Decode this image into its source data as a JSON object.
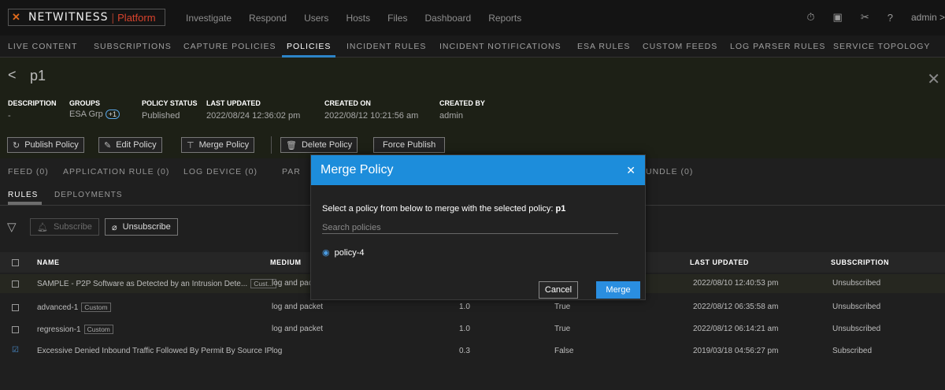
{
  "brand": {
    "name": "NETWITNESS",
    "separator": "|",
    "platform": "Platform"
  },
  "main_nav": [
    "Investigate",
    "Respond",
    "Users",
    "Hosts",
    "Files",
    "Dashboard",
    "Reports"
  ],
  "top_icons": {
    "timer": "⏱",
    "tasks": "▣",
    "tools": "✂",
    "help": "?",
    "user": "admin >"
  },
  "admin_tabs": [
    "LIVE CONTENT",
    "SUBSCRIPTIONS",
    "CAPTURE POLICIES",
    "POLICIES",
    "INCIDENT RULES",
    "INCIDENT NOTIFICATIONS",
    "ESA RULES",
    "CUSTOM FEEDS",
    "LOG PARSER RULES",
    "SERVICE TOPOLOGY"
  ],
  "active_tab": "POLICIES",
  "policy": {
    "back": "<",
    "title": "p1",
    "close": "✕",
    "meta": {
      "description_label": "DESCRIPTION",
      "description_value": "-",
      "groups_label": "GROUPS",
      "groups_value": "ESA Grp",
      "groups_badge": "+1",
      "status_label": "POLICY STATUS",
      "status_value": "Published",
      "updated_label": "LAST UPDATED",
      "updated_value": "2022/08/24 12:36:02 pm",
      "created_label": "CREATED ON",
      "created_value": "2022/08/12 10:21:56 am",
      "createdby_label": "CREATED BY",
      "createdby_value": "admin"
    },
    "toolbar": {
      "publish": "Publish Policy",
      "edit": "Edit Policy",
      "merge": "Merge Policy",
      "delete": "Delete Policy",
      "force": "Force Publish"
    }
  },
  "content_tabs": {
    "feed": "FEED (0)",
    "app_rule": "APPLICATION RULE (0)",
    "log_device": "LOG DEVICE (0)",
    "par": "PAR",
    "bundle": "UNDLE (0)"
  },
  "sub_tabs": {
    "rules": "RULES",
    "deployments": "DEPLOYMENTS"
  },
  "actions": {
    "subscribe": "Subscribe",
    "unsubscribe": "Unsubscribe"
  },
  "table": {
    "headers": {
      "name": "NAME",
      "medium": "MEDIUM",
      "updated": "LAST UPDATED",
      "subscription": "SUBSCRIPTION"
    },
    "rows": [
      {
        "name": "SAMPLE - P2P Software as Detected by an Intrusion Dete...",
        "tag": "Cust...",
        "medium": "log and pack",
        "version": "",
        "flag": "",
        "updated": "2022/08/10 12:40:53 pm",
        "subscription": "Unsubscribed",
        "checked": false
      },
      {
        "name": "advanced-1",
        "tag": "Custom",
        "medium": "log and packet",
        "version": "1.0",
        "flag": "True",
        "updated": "2022/08/12 06:35:58 am",
        "subscription": "Unsubscribed",
        "checked": false
      },
      {
        "name": "regression-1",
        "tag": "Custom",
        "medium": "log and packet",
        "version": "1.0",
        "flag": "True",
        "updated": "2022/08/12 06:14:21 am",
        "subscription": "Unsubscribed",
        "checked": false
      },
      {
        "name": "Excessive Denied Inbound Traffic Followed By Permit By Source IP",
        "tag": "",
        "medium": "log",
        "version": "0.3",
        "flag": "False",
        "updated": "2019/03/18 04:56:27 pm",
        "subscription": "Subscribed",
        "checked": true
      }
    ]
  },
  "modal": {
    "title": "Merge Policy",
    "close": "✕",
    "text": "Select a policy from below to merge with the selected policy:",
    "policy": "p1",
    "search_placeholder": "Search policies",
    "option": "policy-4",
    "cancel": "Cancel",
    "merge": "Merge"
  },
  "colors": {
    "accent": "#1d8ddb",
    "brand": "#d9432d"
  }
}
